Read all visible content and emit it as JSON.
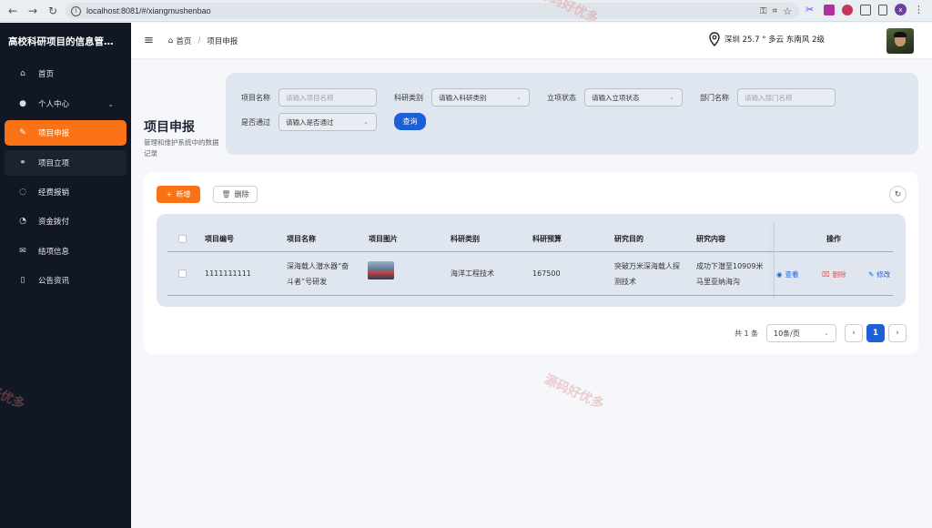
{
  "browser": {
    "url": "localhost:8081/#/xiangmushenbao",
    "profile_initial": "x"
  },
  "sidebar": {
    "brand": "高校科研项目的信息管…",
    "items": [
      {
        "label": "首页",
        "icon": "home-icon"
      },
      {
        "label": "个人中心",
        "icon": "user-icon"
      },
      {
        "label": "项目申报",
        "icon": "edit-icon"
      },
      {
        "label": "项目立项",
        "icon": "chat-icon"
      },
      {
        "label": "经费报销",
        "icon": "message-icon"
      },
      {
        "label": "资金拨付",
        "icon": "chart-icon"
      },
      {
        "label": "结项信息",
        "icon": "mail-icon"
      },
      {
        "label": "公告资讯",
        "icon": "book-icon"
      }
    ]
  },
  "topbar": {
    "crumb_home": "首页",
    "crumb_current": "项目申报",
    "weather": "深圳 25.7 ° 多云 东南风 2级"
  },
  "page": {
    "title": "项目申报",
    "subtitle": "管理和维护系统中的数据记录"
  },
  "filter": {
    "name_label": "项目名称",
    "name_placeholder": "请输入项目名称",
    "category_label": "科研类别",
    "category_value": "请输入科研类别",
    "status_label": "立项状态",
    "status_value": "请输入立项状态",
    "dept_label": "部门名称",
    "dept_placeholder": "请输入部门名称",
    "pass_label": "是否通过",
    "pass_value": "请输入是否通过",
    "query_button": "查询"
  },
  "toolbar": {
    "add_label": "新增",
    "delete_label": "删除"
  },
  "table": {
    "headers": [
      "项目编号",
      "项目名称",
      "项目图片",
      "科研类别",
      "科研预算",
      "研究目的",
      "研究内容",
      "操作"
    ],
    "rows": [
      {
        "id": "1111111111",
        "name_line1": "深海载人潜水器“奋",
        "name_line2": "斗者”号研发",
        "category": "海洋工程技术",
        "budget": "167500",
        "purpose_line1": "突破万米深海载人探",
        "purpose_line2": "测技术",
        "content_line1": "成功下潜至10909米",
        "content_line2": "马里亚纳海沟",
        "actions": {
          "view": "查看",
          "delete": "删除",
          "edit": "修改"
        }
      }
    ]
  },
  "pagination": {
    "total": "共 1 条",
    "page_size": "10条/页",
    "current_page": "1"
  },
  "watermark": "源码好优多",
  "colors": {
    "accent": "#f97316",
    "primary": "#1d5fd6",
    "sidebar_bg": "#111824"
  }
}
